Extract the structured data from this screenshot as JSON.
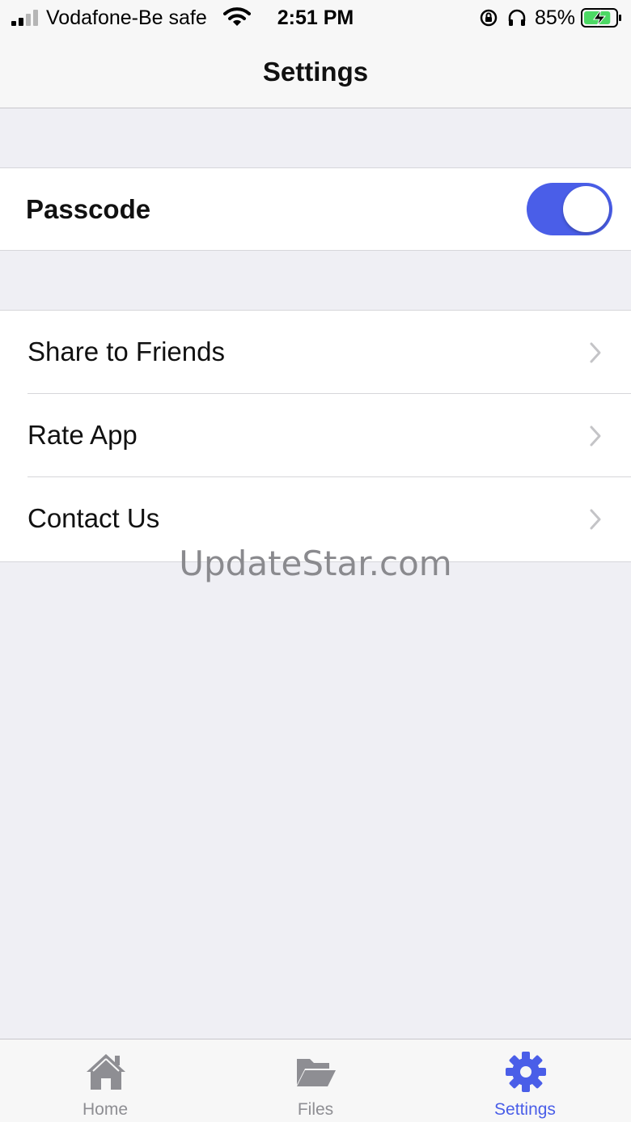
{
  "status_bar": {
    "carrier": "Vodafone-Be safe",
    "time": "2:51 PM",
    "battery_percent": "85%",
    "battery_level": 0.85,
    "icons": [
      "signal-icon",
      "wifi-icon",
      "rotation-lock-icon",
      "headphones-icon",
      "battery-charging-icon"
    ]
  },
  "nav": {
    "title": "Settings"
  },
  "passcode": {
    "label": "Passcode",
    "toggle_on": true,
    "toggle_color": "#4a5ee8"
  },
  "links": [
    {
      "label": "Share to Friends",
      "icon": "chevron-right-icon"
    },
    {
      "label": "Rate App",
      "icon": "chevron-right-icon"
    },
    {
      "label": "Contact Us",
      "icon": "chevron-right-icon"
    }
  ],
  "watermark": "UpdateStar.com",
  "tabs": [
    {
      "label": "Home",
      "icon": "home-icon",
      "active": false
    },
    {
      "label": "Files",
      "icon": "folder-open-icon",
      "active": false
    },
    {
      "label": "Settings",
      "icon": "gear-icon",
      "active": true
    }
  ],
  "colors": {
    "accent": "#4a5ee8",
    "inactive_tab": "#8e8e93",
    "background": "#efeff4"
  }
}
